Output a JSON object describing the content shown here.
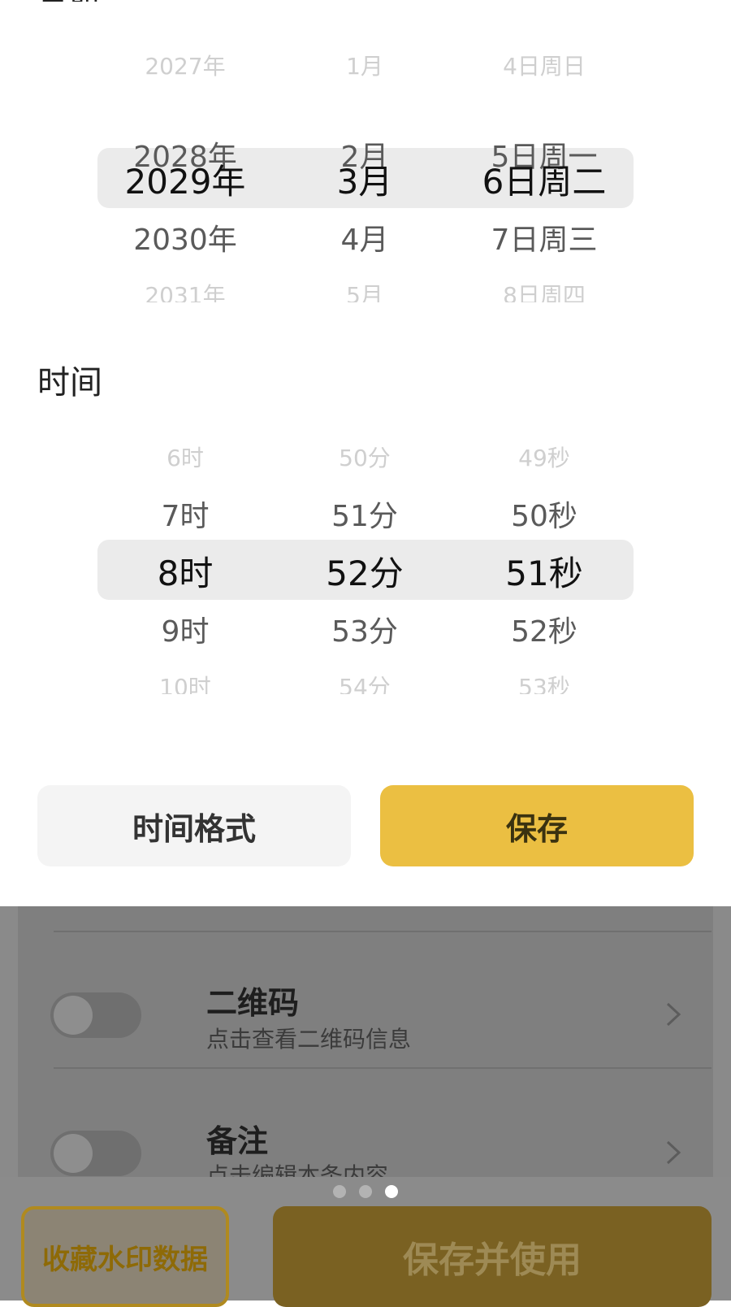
{
  "date_picker": {
    "section_title": "日期",
    "year": {
      "items": [
        "2027年",
        "2028年",
        "2029年",
        "2030年",
        "2031年"
      ],
      "selected": "2029年"
    },
    "month": {
      "items": [
        "1月",
        "2月",
        "3月",
        "4月",
        "5月"
      ],
      "selected": "3月"
    },
    "day": {
      "items": [
        "4日周日",
        "5日周一",
        "6日周二",
        "7日周三",
        "8日周四"
      ],
      "selected": "6日周二"
    }
  },
  "time_picker": {
    "section_title": "时间",
    "hour": {
      "items": [
        "6时",
        "7时",
        "8时",
        "9时",
        "10时"
      ],
      "selected": "8时"
    },
    "minute": {
      "items": [
        "50分",
        "51分",
        "52分",
        "53分",
        "54分"
      ],
      "selected": "52分"
    },
    "second": {
      "items": [
        "49秒",
        "50秒",
        "51秒",
        "52秒",
        "53秒"
      ],
      "selected": "51秒"
    }
  },
  "actions": {
    "format_label": "时间格式",
    "save_label": "保存"
  },
  "background_list": {
    "items": [
      {
        "title": "二维码",
        "subtitle": "点击查看二维码信息",
        "toggle_on": false
      },
      {
        "title": "备注",
        "subtitle": "点击编辑本条内容",
        "toggle_on": false
      }
    ]
  },
  "pager": {
    "count": 3,
    "active_index": 2
  },
  "bottom_bar": {
    "collect_label": "收藏水印数据",
    "use_label": "保存并使用"
  },
  "colors": {
    "accent": "#ebbf42",
    "highlight": "#ebebeb",
    "overlay": "#8a8a8a"
  }
}
